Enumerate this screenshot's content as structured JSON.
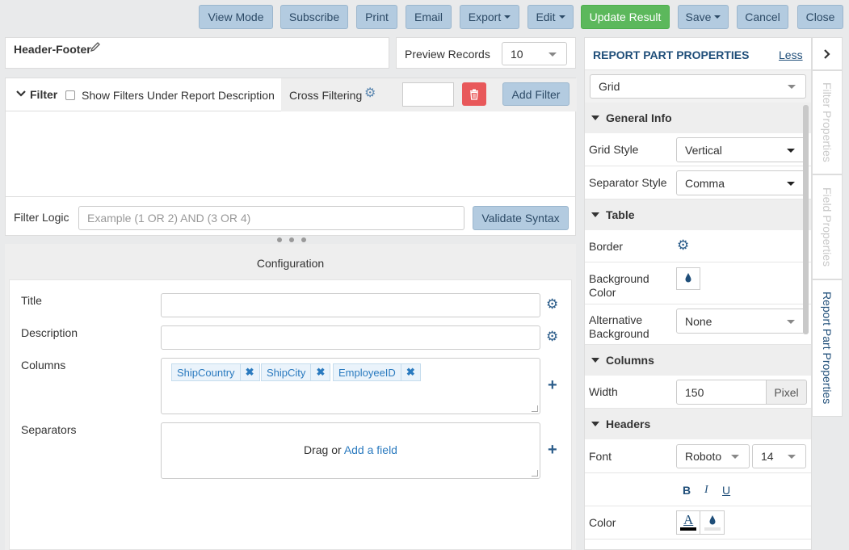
{
  "toolbar": {
    "view_mode": "View Mode",
    "subscribe": "Subscribe",
    "print": "Print",
    "email": "Email",
    "export": "Export",
    "edit": "Edit",
    "update_result": "Update Result",
    "save": "Save",
    "cancel": "Cancel",
    "close": "Close"
  },
  "report": {
    "name": "Header-Footer",
    "preview_label": "Preview Records",
    "preview_value": "10"
  },
  "filter": {
    "title": "Filter",
    "show_under_desc": "Show Filters Under Report Description",
    "cross_filtering": "Cross Filtering",
    "add_filter": "Add Filter",
    "logic_label": "Filter Logic",
    "logic_placeholder": "Example (1 OR 2) AND (3 OR 4)",
    "validate": "Validate Syntax"
  },
  "config": {
    "header": "Configuration",
    "title_label": "Title",
    "description_label": "Description",
    "columns_label": "Columns",
    "separators_label": "Separators",
    "columns": [
      "ShipCountry",
      "ShipCity",
      "EmployeeID"
    ],
    "drag_text": "Drag or",
    "add_field": "Add a field"
  },
  "properties": {
    "header": "REPORT PART PROPERTIES",
    "less": "Less",
    "part_type": "Grid",
    "general_info": "General Info",
    "grid_style_label": "Grid Style",
    "grid_style_value": "Vertical",
    "separator_style_label": "Separator Style",
    "separator_style_value": "Comma",
    "table": "Table",
    "border_label": "Border",
    "background_color_label_1": "Background",
    "background_color_label_2": "Color",
    "alt_background_label_1": "Alternative",
    "alt_background_label_2": "Background",
    "alt_background_value": "None",
    "columns": "Columns",
    "width_label": "Width",
    "width_value": "150",
    "width_unit": "Pixel",
    "headers": "Headers",
    "font_label": "Font",
    "font_value": "Roboto",
    "font_size": "14",
    "bold": "B",
    "italic": "I",
    "underline": "U",
    "color_label": "Color",
    "text_color_glyph": "A"
  },
  "side_tabs": {
    "filter_properties": "Filter Properties",
    "field_properties": "Field Properties",
    "report_part_properties": "Report Part Properties"
  },
  "colors": {
    "accent_blue": "#b3cbe0",
    "update_green": "#5cb85c",
    "delete_red": "#e8585a",
    "link_blue": "#2a7abf"
  }
}
